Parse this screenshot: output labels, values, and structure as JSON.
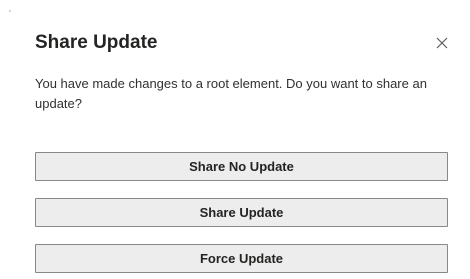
{
  "dialog": {
    "title": "Share Update",
    "message": "You have made changes to a root element. Do you want to share an update?",
    "close_icon": "close-icon",
    "buttons": [
      {
        "label": "Share No Update"
      },
      {
        "label": "Share Update"
      },
      {
        "label": "Force Update"
      }
    ]
  },
  "colors": {
    "background": "#ffffff",
    "button_background": "#ededed",
    "button_border": "#8a8886",
    "text": "#252423"
  }
}
